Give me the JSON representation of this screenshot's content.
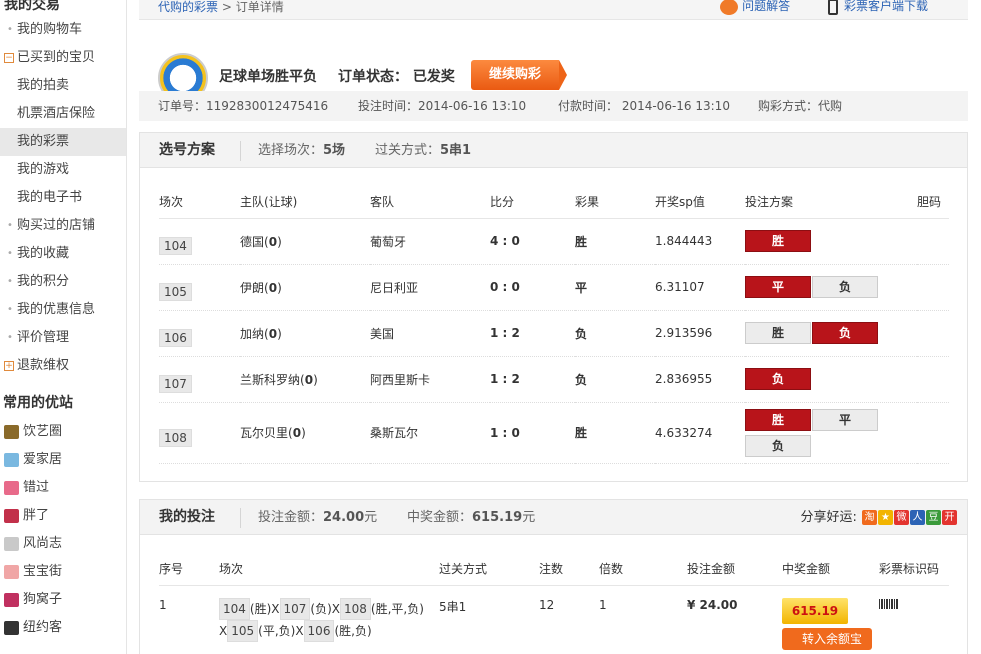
{
  "sidebar": {
    "title": "我的交易",
    "items": [
      {
        "label": "我的购物车"
      },
      {
        "label": "已买到的宝贝"
      },
      {
        "label": "我的拍卖"
      },
      {
        "label": "机票酒店保险"
      },
      {
        "label": "我的彩票"
      },
      {
        "label": "我的游戏"
      },
      {
        "label": "我的电子书"
      },
      {
        "label": "购买过的店铺"
      },
      {
        "label": "我的收藏"
      },
      {
        "label": "我的积分"
      },
      {
        "label": "我的优惠信息"
      },
      {
        "label": "评价管理"
      },
      {
        "label": "退款维权"
      }
    ],
    "fav_title": "常用的优站",
    "favs": [
      {
        "label": "饮艺圈",
        "color": "#8a6a2a"
      },
      {
        "label": "爱家居",
        "color": "#7ab8e0"
      },
      {
        "label": "错过",
        "color": "#e86a8a"
      },
      {
        "label": "胖了",
        "color": "#c2304a"
      },
      {
        "label": "风尚志",
        "color": "#c9c9c9"
      },
      {
        "label": "宝宝街",
        "color": "#f0a6a6"
      },
      {
        "label": "狗窝子",
        "color": "#c03060"
      },
      {
        "label": "纽约客",
        "color": "#333333"
      }
    ]
  },
  "topbar": {
    "crumb_link": "代购的彩票",
    "crumb_sep": ">",
    "crumb_current": "订单详情",
    "help": "问题解答",
    "client": "彩票客户端下载"
  },
  "header": {
    "title": "足球单场胜平负",
    "status_label": "订单状态：",
    "status_value": "已发奖",
    "continue_btn": "继续购彩"
  },
  "info": {
    "order_no": "订单号：1192830012475416",
    "bet_time": "投注时间：2014-06-16 13:10",
    "pay_time": "付款时间： 2014-06-16 13:10",
    "buy_mode": "购彩方式：代购"
  },
  "selection": {
    "title": "选号方案",
    "matches_label": "选择场次：",
    "matches_value": "5场",
    "pass_label": "过关方式：",
    "pass_value": "5串1",
    "headers": [
      "场次",
      "主队(让球)",
      "客队",
      "比分",
      "彩果",
      "开奖sp值",
      "投注方案",
      "胆码"
    ],
    "rows": [
      {
        "no": "104",
        "home": "德国",
        "handicap": "0",
        "away": "葡萄牙",
        "score": "4 : 0",
        "result": "胜",
        "sp": "1.844443",
        "picks": [
          {
            "label": "胜",
            "on": true
          }
        ]
      },
      {
        "no": "105",
        "home": "伊朗",
        "handicap": "0",
        "away": "尼日利亚",
        "score": "0 : 0",
        "result": "平",
        "sp": "6.31107",
        "picks": [
          {
            "label": "平",
            "on": true
          },
          {
            "label": "负",
            "on": false
          }
        ]
      },
      {
        "no": "106",
        "home": "加纳",
        "handicap": "0",
        "away": "美国",
        "score": "1 : 2",
        "result": "负",
        "sp": "2.913596",
        "picks": [
          {
            "label": "胜",
            "on": false
          },
          {
            "label": "负",
            "on": true
          }
        ]
      },
      {
        "no": "107",
        "home": "兰斯科罗纳",
        "handicap": "0",
        "away": "阿西里斯卡",
        "score": "1 : 2",
        "result": "负",
        "sp": "2.836955",
        "picks": [
          {
            "label": "负",
            "on": true
          }
        ]
      },
      {
        "no": "108",
        "home": "瓦尔贝里",
        "handicap": "0",
        "away": "桑斯瓦尔",
        "score": "1 : 0",
        "result": "胜",
        "sp": "4.633274",
        "picks": [
          {
            "label": "胜",
            "on": true
          },
          {
            "label": "平",
            "on": false
          },
          {
            "label": "负",
            "on": false
          }
        ]
      }
    ]
  },
  "bets": {
    "title": "我的投注",
    "amount_label": "投注金额：",
    "amount_value": "24.00",
    "amount_unit": "元",
    "prize_label": "中奖金额：",
    "prize_value": "615.19",
    "prize_unit": "元",
    "share_label": "分享好运:",
    "share_icons": [
      {
        "label": "淘",
        "color": "#f06a1d"
      },
      {
        "label": "★",
        "color": "#f2b400"
      },
      {
        "label": "微",
        "color": "#e3342f"
      },
      {
        "label": "人",
        "color": "#2c63b5"
      },
      {
        "label": "豆",
        "color": "#3a9a3a"
      },
      {
        "label": "开",
        "color": "#e3342f"
      }
    ],
    "headers": [
      "序号",
      "场次",
      "过关方式",
      "注数",
      "倍数",
      "投注金额",
      "中奖金额",
      "彩票标识码"
    ],
    "row": {
      "idx": "1",
      "games": [
        {
          "no": "104",
          "pick": "(胜)X"
        },
        {
          "no": "107",
          "pick": "(负)X"
        },
        {
          "no": "108",
          "pick": "(胜,平,负)"
        },
        {
          "no": "X",
          "pick": ""
        },
        {
          "no": "105",
          "pick": "(平,负)X"
        },
        {
          "no": "106",
          "pick": "(胜,负)"
        }
      ],
      "pass": "5串1",
      "notes": "12",
      "multiple": "1",
      "amount": "¥ 24.00",
      "prize": "615.19",
      "to_balance": "转入余额宝"
    }
  }
}
